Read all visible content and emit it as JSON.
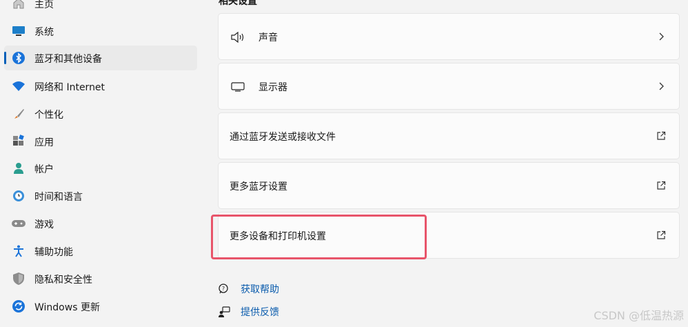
{
  "sidebar": {
    "items": [
      {
        "label": "主页",
        "icon": "home-icon"
      },
      {
        "label": "系统",
        "icon": "system-display-icon"
      },
      {
        "label": "蓝牙和其他设备",
        "icon": "bluetooth-icon",
        "active": true
      },
      {
        "label": "网络和 Internet",
        "icon": "wifi-icon"
      },
      {
        "label": "个性化",
        "icon": "paintbrush-icon"
      },
      {
        "label": "应用",
        "icon": "apps-icon"
      },
      {
        "label": "帐户",
        "icon": "account-icon"
      },
      {
        "label": "时间和语言",
        "icon": "clock-globe-icon"
      },
      {
        "label": "游戏",
        "icon": "gamepad-icon"
      },
      {
        "label": "辅助功能",
        "icon": "accessibility-icon"
      },
      {
        "label": "隐私和安全性",
        "icon": "shield-icon"
      },
      {
        "label": "Windows 更新",
        "icon": "update-sync-icon"
      }
    ]
  },
  "related": {
    "title": "相关设置",
    "cards": [
      {
        "label": "声音",
        "icon": "speaker-icon",
        "action": "chevron-right-icon"
      },
      {
        "label": "显示器",
        "icon": "monitor-icon",
        "action": "chevron-right-icon"
      },
      {
        "label": "通过蓝牙发送或接收文件",
        "action": "external-link-icon"
      },
      {
        "label": "更多蓝牙设置",
        "action": "external-link-icon"
      },
      {
        "label": "更多设备和打印机设置",
        "action": "external-link-icon",
        "highlighted": true
      }
    ]
  },
  "help": {
    "get_help": "获取帮助",
    "feedback": "提供反馈"
  },
  "watermark": "CSDN @低温热源",
  "colors": {
    "accent": "#005fb8",
    "link": "#0b5cad",
    "highlight": "#e8546a"
  }
}
